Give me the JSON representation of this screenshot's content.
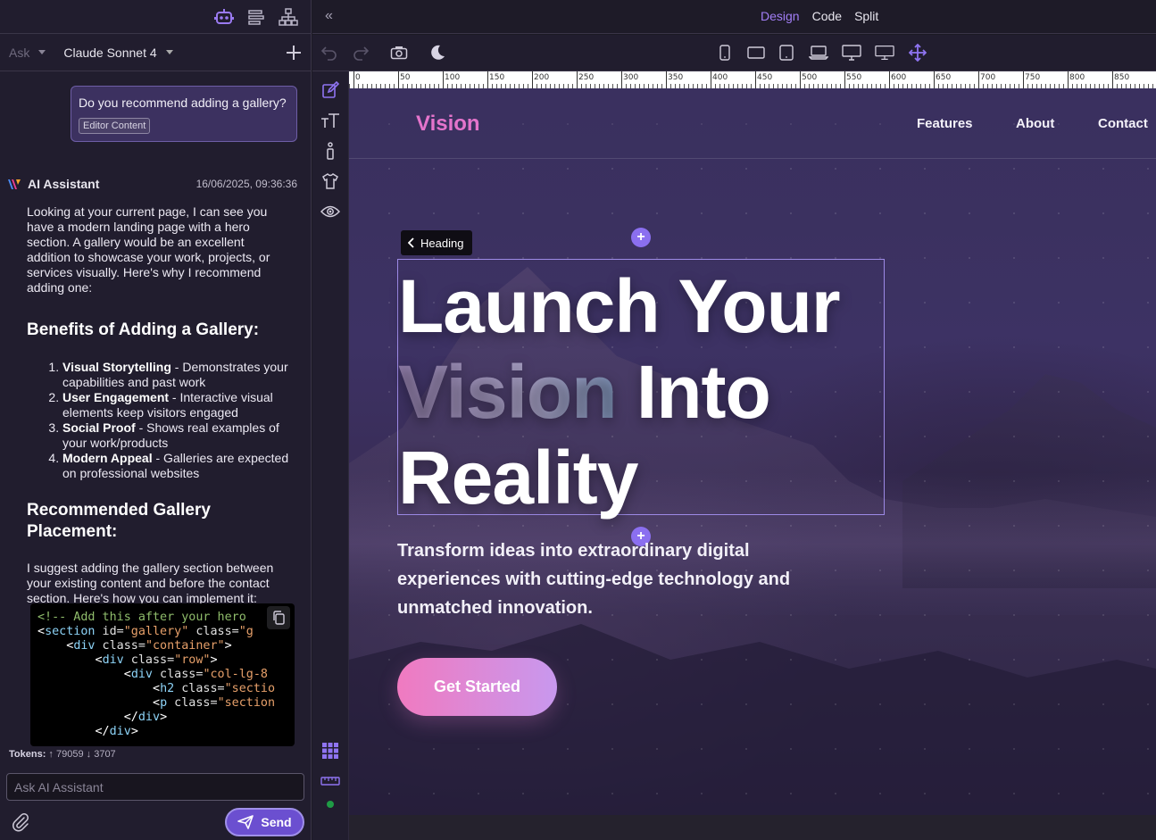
{
  "left_panel": {
    "top_icons": [
      "robot-icon",
      "list-icon",
      "sitemap-icon"
    ],
    "mode_select": "Ask",
    "model_select": "Claude Sonnet 4",
    "user_message": {
      "text": "Do you recommend adding a gallery?",
      "chip": "Editor Content"
    },
    "assistant": {
      "name": "AI Assistant",
      "timestamp": "16/06/2025, 09:36:36",
      "intro": "Looking at your current page, I can see you have a modern landing page with a hero section. A gallery would be an excellent addition to showcase your work, projects, or services visually. Here's why I recommend adding one:",
      "benefits_heading": "Benefits of Adding a Gallery:",
      "benefits": [
        {
          "title": "Visual Storytelling",
          "desc": " - Demonstrates your capabilities and past work"
        },
        {
          "title": "User Engagement",
          "desc": " - Interactive visual elements keep visitors engaged"
        },
        {
          "title": "Social Proof",
          "desc": " - Shows real examples of your work/products"
        },
        {
          "title": "Modern Appeal",
          "desc": " - Galleries are expected on professional websites"
        }
      ],
      "placement_heading": "Recommended Gallery Placement:",
      "placement_text": "I suggest adding the gallery section between your existing content and before the contact section. Here's how you can implement it:"
    },
    "code_lines": [
      {
        "indent": "",
        "parts": [
          [
            "cmt",
            "<!-- Add this after your hero"
          ]
        ]
      },
      {
        "indent": "",
        "parts": [
          [
            "tag",
            "<"
          ],
          [
            "tn",
            "section"
          ],
          [
            "at",
            " id="
          ],
          [
            "st",
            "\"gallery\""
          ],
          [
            "at",
            " class="
          ],
          [
            "st",
            "\"g"
          ]
        ]
      },
      {
        "indent": "    ",
        "parts": [
          [
            "tag",
            "<"
          ],
          [
            "tn",
            "div"
          ],
          [
            "at",
            " class="
          ],
          [
            "st",
            "\"container\""
          ],
          [
            "tag",
            ">"
          ]
        ]
      },
      {
        "indent": "        ",
        "parts": [
          [
            "tag",
            "<"
          ],
          [
            "tn",
            "div"
          ],
          [
            "at",
            " class="
          ],
          [
            "st",
            "\"row\""
          ],
          [
            "tag",
            ">"
          ]
        ]
      },
      {
        "indent": "            ",
        "parts": [
          [
            "tag",
            "<"
          ],
          [
            "tn",
            "div"
          ],
          [
            "at",
            " class="
          ],
          [
            "st",
            "\"col-lg-8"
          ]
        ]
      },
      {
        "indent": "                ",
        "parts": [
          [
            "tag",
            "<"
          ],
          [
            "tn",
            "h2"
          ],
          [
            "at",
            " class="
          ],
          [
            "st",
            "\"sectio"
          ]
        ]
      },
      {
        "indent": "                ",
        "parts": [
          [
            "tag",
            "<"
          ],
          [
            "tn",
            "p"
          ],
          [
            "at",
            " class="
          ],
          [
            "st",
            "\"section"
          ]
        ]
      },
      {
        "indent": "            ",
        "parts": [
          [
            "tag",
            "</"
          ],
          [
            "tn",
            "div"
          ],
          [
            "tag",
            ">"
          ]
        ]
      },
      {
        "indent": "        ",
        "parts": [
          [
            "tag",
            "</"
          ],
          [
            "tn",
            "div"
          ],
          [
            "tag",
            ">"
          ]
        ]
      }
    ],
    "tokens_label": "Tokens:",
    "tokens_up": "79059",
    "tokens_down": "3707",
    "input_placeholder": "Ask AI Assistant",
    "send_label": "Send"
  },
  "top_bar": {
    "modes": [
      {
        "label": "Design",
        "active": true
      },
      {
        "label": "Code",
        "active": false
      },
      {
        "label": "Split",
        "active": false
      }
    ]
  },
  "toolbar_icons": [
    "undo-icon",
    "redo-icon",
    "camera-icon",
    "moon-icon",
    "phone-icon",
    "tablet-landscape-icon",
    "tablet-icon",
    "laptop-icon",
    "desktop-icon",
    "monitor-icon",
    "move-icon"
  ],
  "side_tools": [
    "edit-icon",
    "typography-icon",
    "info-icon",
    "shirt-icon",
    "eye-icon",
    "grid-icon",
    "ruler-icon",
    "status-dot-icon"
  ],
  "ruler_labels": [
    "0",
    "50",
    "100",
    "150",
    "200",
    "250",
    "300",
    "350",
    "400",
    "450",
    "500",
    "550",
    "600",
    "650",
    "700",
    "750",
    "800",
    "850"
  ],
  "canvas": {
    "logo": "Vision",
    "nav_links": [
      "Features",
      "About",
      "Contact"
    ],
    "heading_tag": "Heading",
    "hero_line1": "Launch Your",
    "hero_grad": "Vision",
    "hero_line2_rest": " Into",
    "hero_line3": "Reality",
    "subtitle": "Transform ideas into extraordinary digital experiences with cutting-edge technology and unmatched innovation.",
    "cta": "Get Started"
  },
  "colors": {
    "accent": "#a27ef6",
    "logo": "#e574cc",
    "send": "#6b4fd0"
  }
}
